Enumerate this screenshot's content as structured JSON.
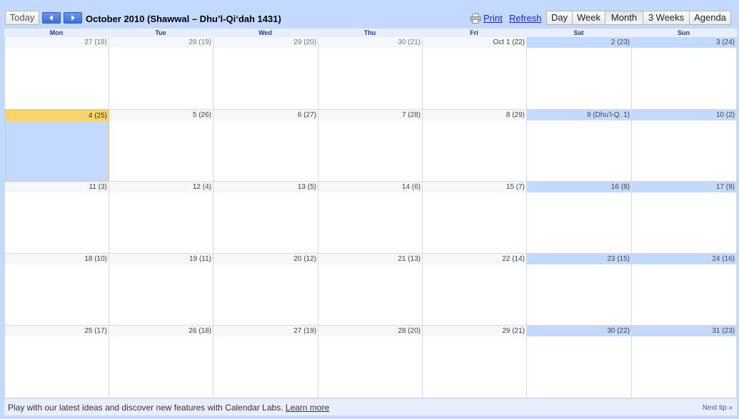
{
  "toolbar": {
    "today_label": "Today",
    "title": "October 2010 (Shawwal – Dhu’l-Qi‘dah 1431)",
    "print_label": "Print",
    "refresh_label": "Refresh",
    "views": [
      "Day",
      "Week",
      "Month",
      "3 Weeks",
      "Agenda"
    ],
    "active_view": "Month"
  },
  "weekdays": [
    "Mon",
    "Tue",
    "Wed",
    "Thu",
    "Fri",
    "Sat",
    "Sun"
  ],
  "weeks": [
    [
      "27 (18)",
      "28 (19)",
      "29 (20)",
      "30 (21)",
      "Oct 1 (22)",
      "2 (23)",
      "3 (24)"
    ],
    [
      "4 (25)",
      "5 (26)",
      "6 (27)",
      "7 (28)",
      "8 (29)",
      "9 (Dhu’l-Q. 1)",
      "10 (2)"
    ],
    [
      "11 (3)",
      "12 (4)",
      "13 (5)",
      "14 (6)",
      "15 (7)",
      "16 (8)",
      "17 (9)"
    ],
    [
      "18 (10)",
      "19 (11)",
      "20 (12)",
      "21 (13)",
      "22 (14)",
      "23 (15)",
      "24 (16)"
    ],
    [
      "25 (17)",
      "26 (18)",
      "27 (19)",
      "28 (20)",
      "29 (21)",
      "30 (22)",
      "31 (23)"
    ]
  ],
  "today_label": "4 (25)",
  "footer": {
    "text": "Play with our latest ideas and discover new features with Calendar Labs.",
    "link": "Learn more",
    "next_tip": "Next tip »"
  },
  "colors": {
    "weekend_header": "#c3d9ff",
    "today_header": "#f9d46b",
    "today_fill": "#c3d9ff",
    "link": "#1f1fcc"
  }
}
